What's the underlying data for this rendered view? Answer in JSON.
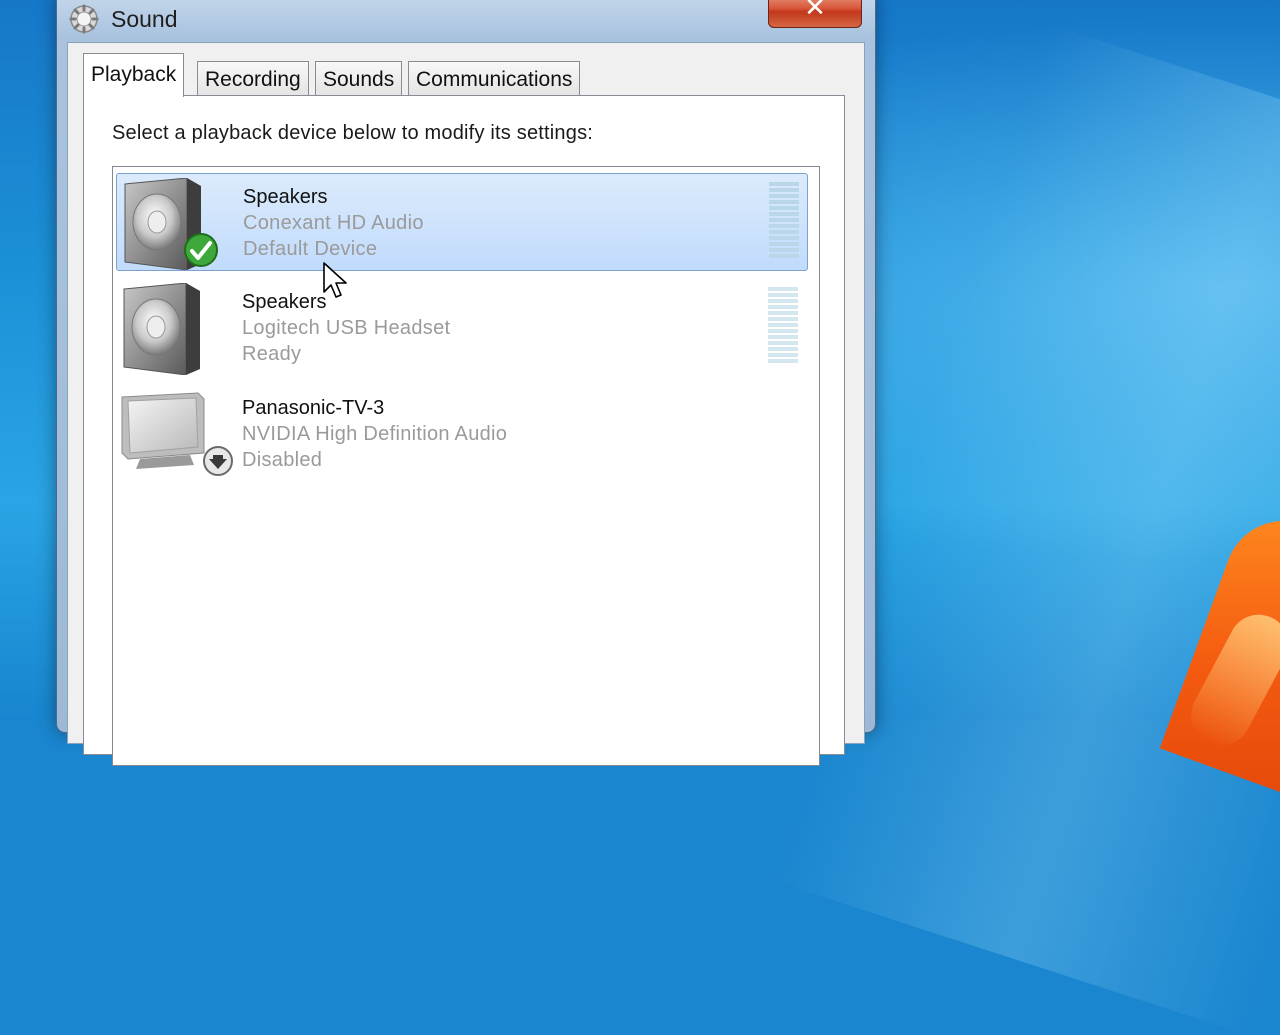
{
  "window": {
    "title": "Sound",
    "close_glyph": "✕",
    "accent_color": "#d9573a"
  },
  "tabs": [
    {
      "label": "Playback",
      "active": true
    },
    {
      "label": "Recording",
      "active": false
    },
    {
      "label": "Sounds",
      "active": false
    },
    {
      "label": "Communications",
      "active": false
    }
  ],
  "playback": {
    "instruction": "Select a playback device below to modify its settings:",
    "devices": [
      {
        "name": "Speakers",
        "driver": "Conexant HD Audio",
        "status": "Default Device",
        "icon": "speaker-icon",
        "badge": "default-check-icon",
        "selected": true
      },
      {
        "name": "Speakers",
        "driver": "Logitech USB Headset",
        "status": "Ready",
        "icon": "speaker-icon",
        "badge": "",
        "selected": false
      },
      {
        "name": "Panasonic-TV-3",
        "driver": "NVIDIA High Definition Audio",
        "status": "Disabled",
        "icon": "monitor-icon",
        "badge": "disabled-arrow-icon",
        "selected": false
      }
    ]
  }
}
